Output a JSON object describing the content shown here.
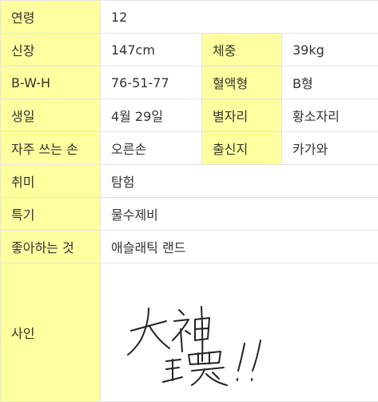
{
  "profile": {
    "age": {
      "label": "연령",
      "value": "12"
    },
    "height": {
      "label": "신장",
      "value": "147cm"
    },
    "weight": {
      "label": "체중",
      "value": "39kg"
    },
    "bwh": {
      "label": "B-W-H",
      "value": "76-51-77"
    },
    "blood": {
      "label": "혈액형",
      "value": "B형"
    },
    "birthday": {
      "label": "생일",
      "value": "4월 29일"
    },
    "sign": {
      "label": "별자리",
      "value": "황소자리"
    },
    "hand": {
      "label": "자주 쓰는 손",
      "value": "오른손"
    },
    "origin": {
      "label": "출신지",
      "value": "카가와"
    },
    "hobby": {
      "label": "취미",
      "value": "탐험"
    },
    "skill": {
      "label": "특기",
      "value": "물수제비"
    },
    "likes": {
      "label": "좋아하는 것",
      "value": "애슬래틱 랜드"
    },
    "signature": {
      "label": "사인",
      "image": "handwritten-signature",
      "text": "大神環!!"
    }
  },
  "colors": {
    "key_bg": "#ffffa0",
    "link": "#2a7ac9",
    "text": "#333333",
    "border": "#e3e3e3"
  }
}
